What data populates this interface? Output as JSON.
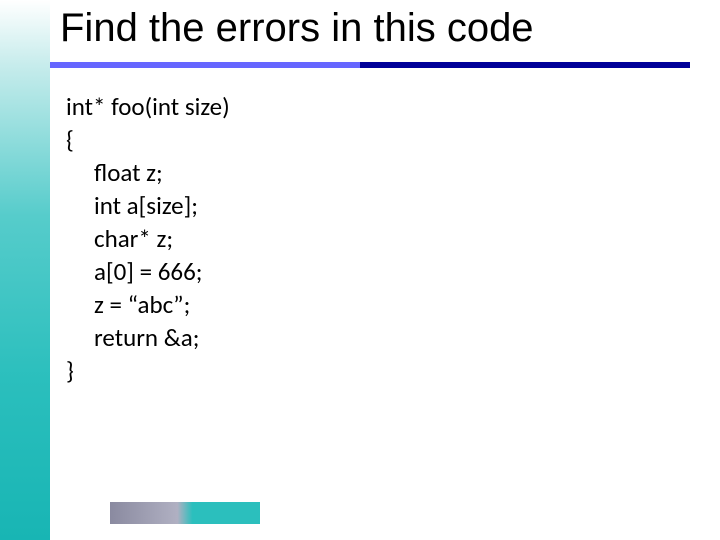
{
  "slide": {
    "title": "Find the errors in this code",
    "code": {
      "l1": "int* foo(int size)",
      "l2": "{",
      "l3": "float z;",
      "l4": "int a[size];",
      "l5": "char* z;",
      "l6": "a[0] = 666;",
      "l7": "z = “abc”;",
      "l8": "return &a;",
      "l9": "}"
    }
  }
}
